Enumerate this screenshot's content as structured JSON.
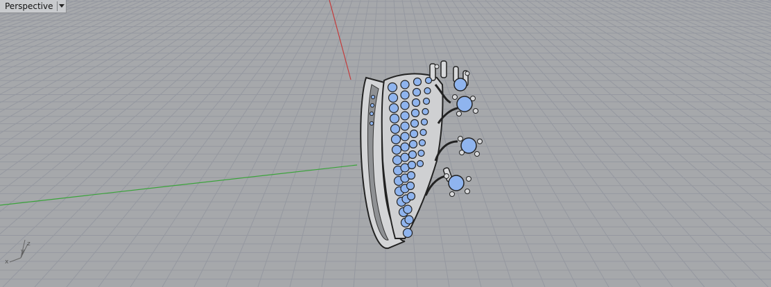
{
  "viewport": {
    "title": "Perspective",
    "dropdown_icon": "chevron-down-icon",
    "background_color": "#a6a8ab",
    "grid_color": "#9598a0",
    "x_axis_color": "#3aa33a",
    "y_axis_color": "#c43a3a"
  },
  "gizmo": {
    "x_label": "x",
    "y_label": "y",
    "z_label": "z"
  },
  "model": {
    "name": "ring",
    "metal_color": "#c8c9cb",
    "gem_color": "#8fb4ee"
  }
}
